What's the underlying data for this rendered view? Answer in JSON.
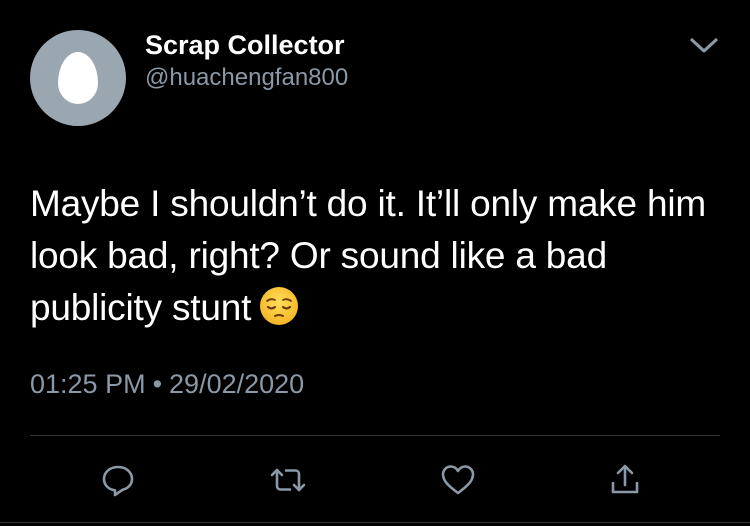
{
  "user": {
    "display_name": "Scrap Collector",
    "handle": "@huachengfan800",
    "avatar_icon": "default-egg-avatar-icon"
  },
  "tweet": {
    "text": "Maybe I shouldn’t do it. It’ll only make him look bad, right? Or sound like a bad publicity stunt",
    "emoji": "pensive-face-emoji"
  },
  "meta": {
    "time": "01:25 PM",
    "separator": "•",
    "date": "29/02/2020"
  },
  "actions": {
    "reply_icon": "reply-icon",
    "retweet_icon": "retweet-icon",
    "like_icon": "heart-icon",
    "share_icon": "share-icon"
  },
  "colors": {
    "background": "#000000",
    "text": "#ffffff",
    "secondary_text": "#8b98a5",
    "divider": "#2f3336",
    "avatar_bg": "#9aa7b1"
  }
}
